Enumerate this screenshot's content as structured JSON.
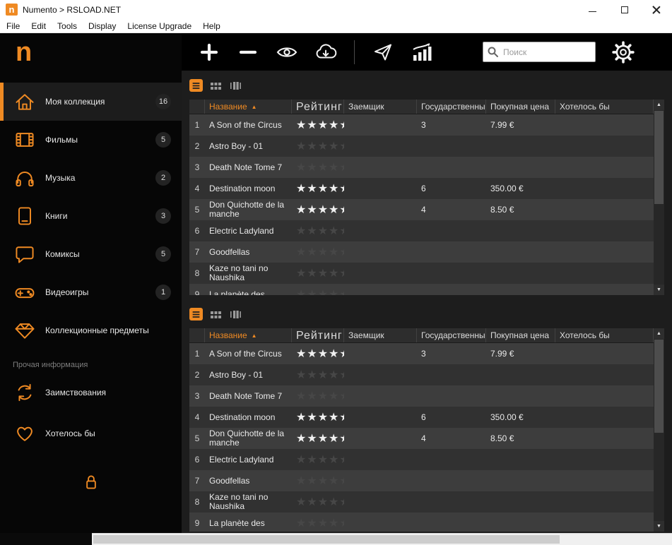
{
  "window": {
    "title": "Numento > RSLOAD.NET",
    "logo_letter": "n"
  },
  "menubar": {
    "items": [
      "File",
      "Edit",
      "Tools",
      "Display",
      "License Upgrade",
      "Help"
    ]
  },
  "sidebar": {
    "logo_letter": "n",
    "items": [
      {
        "label": "Моя коллекция",
        "badge": "16"
      },
      {
        "label": "Фильмы",
        "badge": "5"
      },
      {
        "label": "Музыка",
        "badge": "2"
      },
      {
        "label": "Книги",
        "badge": "3"
      },
      {
        "label": "Комиксы",
        "badge": "5"
      },
      {
        "label": "Видеоигры",
        "badge": "1"
      },
      {
        "label": "Коллекционные предметы",
        "badge": ""
      }
    ],
    "section_label": "Прочая информация",
    "secondary_items": [
      {
        "label": "Заимствования"
      },
      {
        "label": "Хотелось бы"
      }
    ]
  },
  "toolbar": {
    "search_placeholder": "Поиск"
  },
  "icons": {
    "sort_asc": "▲",
    "scroll_up": "▲",
    "scroll_down": "▼"
  },
  "colors": {
    "accent": "#ef8a23"
  },
  "table": {
    "columns": {
      "num": "",
      "title": "Название",
      "rating": "Рейтинг",
      "borrower": "Заемщик",
      "condition": "Государственный",
      "price": "Покупная цена",
      "wishlist": "Хотелось бы"
    },
    "sort": {
      "column": "Название",
      "direction": "asc"
    },
    "rows": [
      {
        "num": "1",
        "title": "A Son of the Circus",
        "rating": 5,
        "borrower": "",
        "condition": "3",
        "price": "7.99 €",
        "wishlist": ""
      },
      {
        "num": "2",
        "title": "Astro Boy - 01",
        "rating": 0,
        "borrower": "",
        "condition": "",
        "price": "",
        "wishlist": ""
      },
      {
        "num": "3",
        "title": "Death Note Tome 7",
        "rating": 0,
        "borrower": "",
        "condition": "",
        "price": "",
        "wishlist": ""
      },
      {
        "num": "4",
        "title": "Destination moon",
        "rating": 5,
        "borrower": "",
        "condition": "6",
        "price": "350.00 €",
        "wishlist": ""
      },
      {
        "num": "5",
        "title": "Don Quichotte de la manche",
        "rating": 5,
        "borrower": "",
        "condition": "4",
        "price": "8.50 €",
        "wishlist": ""
      },
      {
        "num": "6",
        "title": "Electric Ladyland",
        "rating": 0,
        "borrower": "",
        "condition": "",
        "price": "",
        "wishlist": ""
      },
      {
        "num": "7",
        "title": "Goodfellas",
        "rating": 0,
        "borrower": "",
        "condition": "",
        "price": "",
        "wishlist": ""
      },
      {
        "num": "8",
        "title": "Kaze no tani no Naushika",
        "rating": 0,
        "borrower": "",
        "condition": "",
        "price": "",
        "wishlist": ""
      },
      {
        "num": "9",
        "title": "La planète des",
        "rating": 0,
        "borrower": "",
        "condition": "",
        "price": "",
        "wishlist": ""
      }
    ]
  }
}
